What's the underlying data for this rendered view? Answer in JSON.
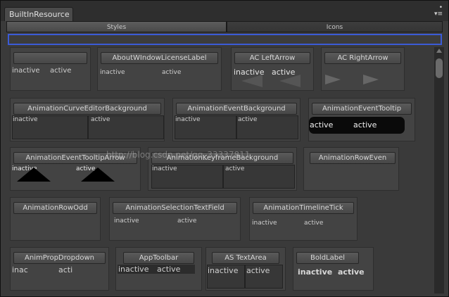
{
  "window": {
    "tab_title": "BuiltInResource",
    "btn_dot": "•",
    "btn_menu": "▾≡"
  },
  "toolbar": {
    "styles": "Styles",
    "icons": "Icons"
  },
  "search": {
    "value": ""
  },
  "states": {
    "inactive": "inactive",
    "active": "active",
    "inac": "inac",
    "acti": "acti"
  },
  "items": [
    {
      "label": ""
    },
    {
      "label": "AboutWIndowLicenseLabel"
    },
    {
      "label": "AC LeftArrow"
    },
    {
      "label": "AC RightArrow"
    },
    {
      "label": "AnimationCurveEditorBackground"
    },
    {
      "label": "AnimationEventBackground"
    },
    {
      "label": "AnimationEventTooltip"
    },
    {
      "label": "AnimationEventTooltipArrow"
    },
    {
      "label": "AnimationKeyframeBackground"
    },
    {
      "label": "AnimationRowEven"
    },
    {
      "label": "AnimationRowOdd"
    },
    {
      "label": "AnimationSelectionTextField"
    },
    {
      "label": "AnimationTimelineTick"
    },
    {
      "label": "AnimPropDropdown"
    },
    {
      "label": "AppToolbar"
    },
    {
      "label": "AS TextArea"
    },
    {
      "label": "BoldLabel"
    }
  ],
  "watermark": "http://blog.csdn.net/qq_33337811"
}
